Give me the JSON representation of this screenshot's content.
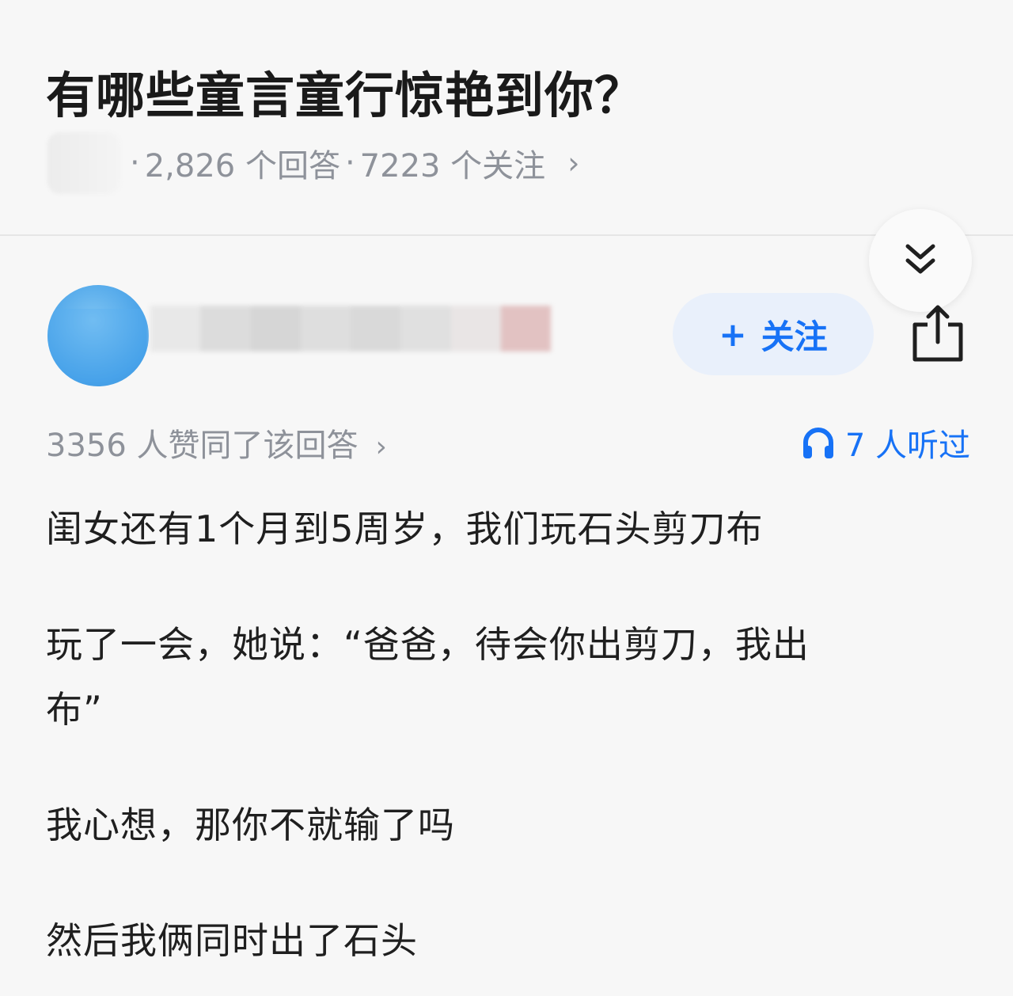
{
  "question": {
    "title": "有哪些童言童行惊艳到你？",
    "answers_count": "2,826 个回答",
    "follow_count": "7223 个关注",
    "separator": "·",
    "chevron": "›"
  },
  "answer": {
    "follow_button_plus": "+",
    "follow_button_label": "关注",
    "upvote_text": "3356 人赞同了该回答",
    "upvote_chevron": "›",
    "listened_text": "7 人听过",
    "paragraphs": [
      "闺女还有1个月到5周岁，我们玩石头剪刀布",
      "玩了一会，她说：“爸爸，待会你出剪刀，我出",
      "布”",
      "我心想，那你不就输了吗",
      "然后我俩同时出了石头"
    ]
  },
  "colors": {
    "accent": "#1772f6",
    "meta_gray": "#8e929a",
    "follow_bg": "#e9f0fb",
    "background": "#f7f7f7"
  },
  "icons": [
    "double-chevron-down-icon",
    "share-icon",
    "headphones-icon"
  ]
}
